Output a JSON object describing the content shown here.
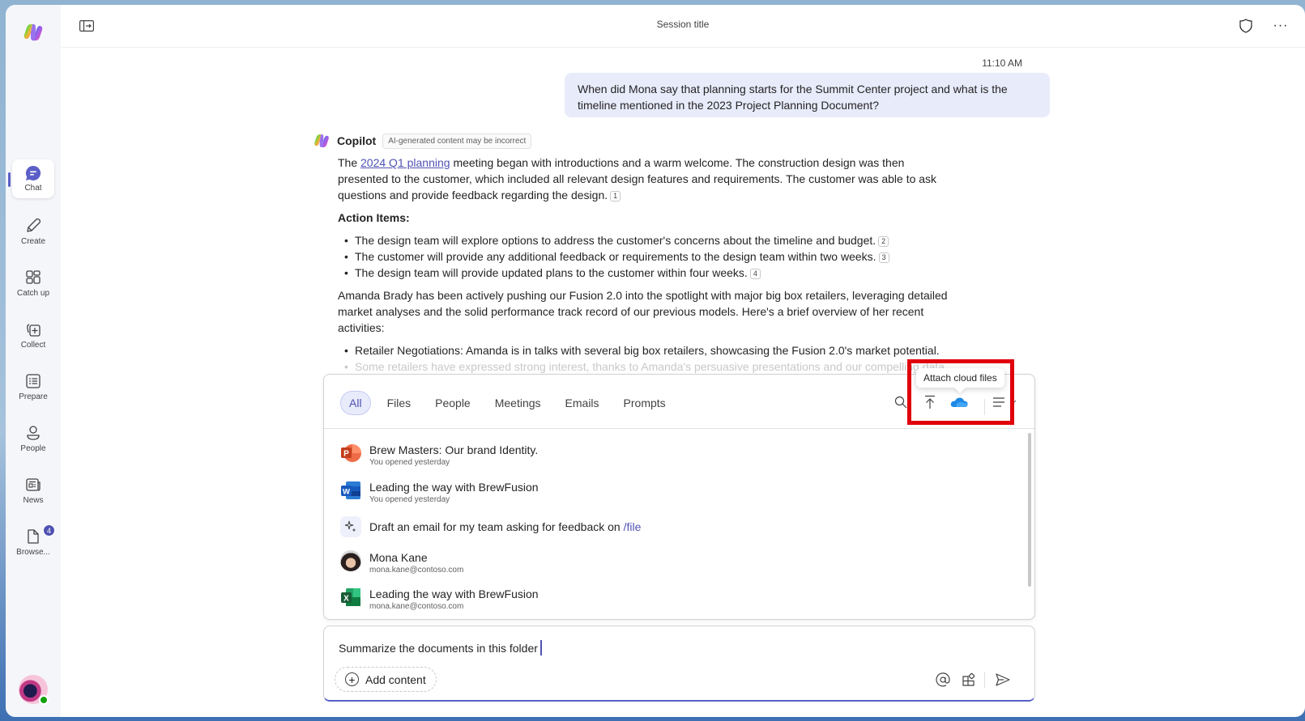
{
  "window": {
    "session_title": "Session title"
  },
  "sidebar": {
    "items": [
      {
        "label": "Chat",
        "icon": "chat-bubble-icon",
        "active": true
      },
      {
        "label": "Create",
        "icon": "pen-icon"
      },
      {
        "label": "Catch up",
        "icon": "grid-icon"
      },
      {
        "label": "Collect",
        "icon": "collection-add-icon"
      },
      {
        "label": "Prepare",
        "icon": "list-icon"
      },
      {
        "label": "People",
        "icon": "person-icon"
      },
      {
        "label": "News",
        "icon": "news-icon"
      },
      {
        "label": "Browse...",
        "icon": "document-icon",
        "badge": "4"
      }
    ]
  },
  "chat": {
    "user_message": {
      "timestamp": "11:10 AM",
      "text": "When did Mona say that planning starts for the Summit Center project and what is the timeline mentioned in the 2023 Project Planning Document?"
    },
    "copilot": {
      "name": "Copilot",
      "disclaimer": "AI-generated content may be incorrect",
      "para1_pre": "The ",
      "para1_link": "2024 Q1 planning",
      "para1_post": " meeting began with introductions and a warm welcome. The construction design was then presented to the customer, which included all relevant design features and requirements. The customer was able to ask questions and provide feedback regarding the design.",
      "para1_ref": "1",
      "action_heading": "Action Items:",
      "action_items": [
        {
          "text": "The design team will explore options to address the customer's concerns about the timeline and budget.",
          "ref": "2"
        },
        {
          "text": "The customer will provide any additional feedback or requirements to the design team within two weeks.",
          "ref": "3"
        },
        {
          "text": "The design team will provide updated plans to the customer within four weeks.",
          "ref": "4"
        }
      ],
      "para2": "Amanda Brady has been actively pushing our Fusion 2.0 into the spotlight with major big box retailers, leveraging detailed market analyses and the solid performance track record of our previous models. Here's a brief overview of her recent activities:",
      "bullets2": [
        "Retailer Negotiations: Amanda is in talks with several big box retailers, showcasing the Fusion 2.0's market potential.",
        "Some retailers have expressed strong interest, thanks to Amanda's persuasive presentations and our compelling data."
      ]
    }
  },
  "picker": {
    "tabs": [
      {
        "label": "All",
        "active": true
      },
      {
        "label": "Files"
      },
      {
        "label": "People"
      },
      {
        "label": "Meetings"
      },
      {
        "label": "Emails"
      },
      {
        "label": "Prompts"
      }
    ],
    "tooltip": "Attach cloud files",
    "items": [
      {
        "type": "powerpoint",
        "title": "Brew Masters: Our brand Identity.",
        "subtitle": "You opened yesterday"
      },
      {
        "type": "word",
        "title": "Leading the way with BrewFusion",
        "subtitle": "You opened yesterday"
      },
      {
        "type": "prompt",
        "title": "Draft an email for my team asking for feedback on ",
        "token": "/file"
      },
      {
        "type": "person",
        "title": "Mona Kane",
        "subtitle": "mona.kane@contoso.com"
      },
      {
        "type": "excel",
        "title": "Leading the way with BrewFusion",
        "subtitle": "mona.kane@contoso.com"
      }
    ]
  },
  "composer": {
    "text": "Summarize the documents in this folder",
    "add_content_label": "Add content"
  },
  "colors": {
    "accent": "#5b5fc7",
    "link": "#4f52b2",
    "highlight_box": "#e0000b",
    "presence": "#13a10e"
  }
}
